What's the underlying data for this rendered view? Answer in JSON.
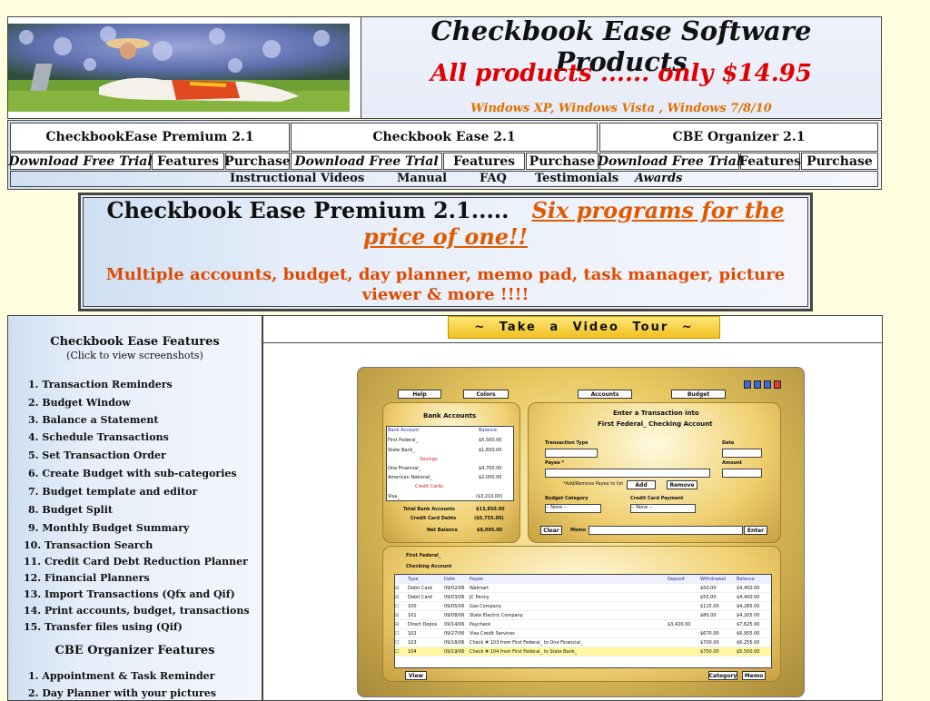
{
  "header": {
    "title": "Checkbook Ease Software Products",
    "price": "All products ...... only $14.95",
    "os": "Windows  XP, Windows Vista , Windows 7/8/10"
  },
  "nav": {
    "products": [
      {
        "name": "CheckbookEase Premium 2.1",
        "download": "Download Free Trial",
        "features": "Features",
        "purchase": "Purchase"
      },
      {
        "name": "Checkbook Ease 2.1",
        "download": "Download Free Trial",
        "features": "Features",
        "purchase": "Purchase"
      },
      {
        "name": "CBE Organizer 2.1",
        "download": "Download Free Trial",
        "features": "Features",
        "purchase": "Purchase"
      }
    ],
    "links": [
      "Instructional Videos",
      "Manual",
      "FAQ",
      "Testimonials",
      "Awards"
    ]
  },
  "promo": {
    "title": "Checkbook Ease Premium 2.1.....",
    "link": "Six programs for the price of one!!",
    "desc": "Multiple accounts, budget, day planner,  memo pad,  task manager,  picture viewer & more !!!!"
  },
  "sidebar": {
    "heading": "Checkbook Ease Features",
    "sub": "(Click to view screenshots)",
    "features": [
      "1.  Transaction Reminders",
      "2.  Budget Window",
      "3.  Balance a Statement",
      "4.  Schedule Transactions",
      "5.  Set Transaction Order",
      "6.  Create Budget with sub-categories",
      "7.  Budget template and editor",
      "8.  Budget Split",
      "9.  Monthly Budget Summary",
      "10.  Transaction Search",
      "11.  Credit Card Debt Reduction Planner",
      "12.  Financial Planners",
      "13.  Import Transactions (Qfx and Qif)",
      "14.  Print accounts, budget, transactions",
      "15.  Transfer files using (Qif)"
    ],
    "org_heading": "CBE Organizer Features",
    "org_features": [
      "1.  Appointment & Task Reminder",
      "2.  Day Planner with your pictures"
    ]
  },
  "tour": "~  Take  a  Video  Tour  ~",
  "app": {
    "toolbar": [
      "Help",
      "Colors",
      "Accounts",
      "Budget"
    ],
    "bank_title": "Bank Accounts",
    "bank_cols": [
      "Bank Account",
      "Balance"
    ],
    "bank_rows": [
      [
        "First Federal_",
        "$5,500.00"
      ],
      [
        "State Bank_",
        "$1,650.00"
      ],
      [
        "Savings",
        ""
      ],
      [
        "One Financial_",
        "$4,700.00"
      ],
      [
        "American National_",
        "$2,000.00"
      ],
      [
        "Credit Cards",
        ""
      ],
      [
        "Visa_",
        "($3,210.00)"
      ]
    ],
    "totals": [
      [
        "Total Bank Accounts",
        "$13,850.00"
      ],
      [
        "Credit Card Debts",
        "($5,755.00)"
      ],
      [
        "Net Balance",
        "$8,095.00"
      ]
    ],
    "enter_title": "Enter a Transaction into",
    "enter_sub": "First Federal_ Checking Account",
    "fields": [
      "Transaction Type",
      "Date",
      "Payee *",
      "Amount",
      "*Add/Remove Payee to list",
      "Budget Category",
      "Credit Card Payment",
      "Memo"
    ],
    "buttons": [
      "Add",
      "Remove",
      "Clear",
      "Enter",
      "View",
      "Category",
      "Memo"
    ],
    "none": "-- None --",
    "acct_label": "First Federal_",
    "acct_sub": "Checking Account",
    "grid_cols": [
      "Type",
      "Date",
      "Payee",
      "Deposit",
      "Withdrawal",
      "Balance"
    ],
    "grid_rows": [
      [
        "Debit Card",
        "09/02/06",
        "Walmart",
        "",
        "$50.00",
        "$4,450.00"
      ],
      [
        "Debit Card",
        "09/03/06",
        "JC Penny",
        "",
        "$50.00",
        "$4,400.00"
      ],
      [
        "100",
        "09/05/06",
        "Gas Company",
        "",
        "$115.00",
        "$4,285.00"
      ],
      [
        "101",
        "09/08/06",
        "State Electric Company",
        "",
        "$80.00",
        "$4,205.00"
      ],
      [
        "Direct Depos",
        "09/14/06",
        "Paycheck",
        "$3,420.00",
        "",
        "$7,625.00"
      ],
      [
        "102",
        "09/27/06",
        "Visa Credit Services",
        "",
        "$670.00",
        "$6,955.00"
      ],
      [
        "103",
        "09/18/06",
        "Check # 103 from First Federal_ to One Financial_",
        "",
        "$700.00",
        "$6,255.00"
      ],
      [
        "104",
        "09/19/06",
        "Check # 104 from First Federal_ to State Bank_",
        "",
        "$750.00",
        "$5,500.00"
      ]
    ]
  }
}
